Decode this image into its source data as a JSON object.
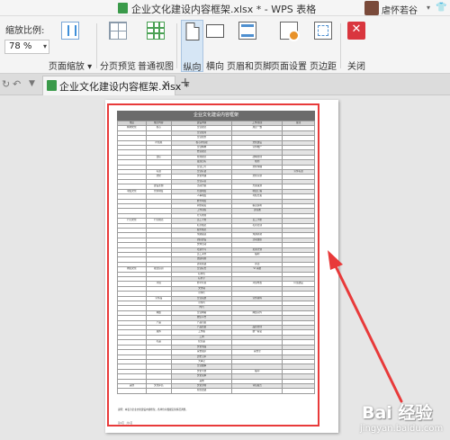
{
  "window": {
    "title": "企业文化建设内容框架.xlsx * - WPS 表格",
    "user_name": "虐怀若谷"
  },
  "ribbon": {
    "zoom_label": "缩放比例:",
    "zoom_value": "78 %",
    "buttons": {
      "page_zoom": "页面缩放",
      "page_break_preview": "分页预览",
      "normal_view": "普通视图",
      "portrait": "纵向",
      "landscape": "横向",
      "header_footer": "页眉和页脚",
      "page_setup": "页面设置",
      "margins": "页边距",
      "close": "关闭"
    }
  },
  "tabs": {
    "active_doc": "企业文化建设内容框架.xlsx *"
  },
  "preview_page": {
    "sheet_title": "企业文化建设内容框架",
    "header": [
      "维度",
      "细分内容",
      "建设内容",
      "工作/备注",
      "备注"
    ],
    "rows": [
      [
        "精神文化",
        "核心",
        "企业理念",
        "理念一致",
        ""
      ],
      [
        "",
        "",
        "企业使命",
        "",
        ""
      ],
      [
        "",
        "",
        "企业愿景",
        "",
        ""
      ],
      [
        "",
        "价值观",
        "核心价值观",
        "文化建设",
        ""
      ],
      [
        "",
        "",
        "企业精神",
        "宣传推广",
        ""
      ],
      [
        "",
        "",
        "经营理念",
        "",
        ""
      ],
      [
        "",
        "目标",
        "管理理念",
        "战略管理",
        ""
      ],
      [
        "",
        "",
        "发展目标",
        "规划",
        ""
      ],
      [
        "",
        "",
        "企业口号",
        "文化传播",
        ""
      ],
      [
        "",
        "标语",
        "企业标语",
        "",
        "宣传标语"
      ],
      [
        "",
        "文化",
        "文化内涵",
        "文化宣讲",
        ""
      ],
      [
        "",
        "",
        "企业宗旨",
        "",
        ""
      ],
      [
        "",
        "建设主题",
        "活动方案",
        "方案策划",
        ""
      ],
      [
        "制度文化",
        "管理制度",
        "行政制度",
        "制度汇编",
        ""
      ],
      [
        "",
        "",
        "人事制度",
        "考核方案",
        ""
      ],
      [
        "",
        "",
        "财务制度",
        "",
        ""
      ],
      [
        "",
        "",
        "岗位职责",
        "职责说明",
        ""
      ],
      [
        "",
        "",
        "工作流程",
        "流程图",
        ""
      ],
      [
        "",
        "",
        "行为准则",
        "",
        ""
      ],
      [
        "行为文化",
        "行为规范",
        "员工守则",
        "员工手册",
        ""
      ],
      [
        "",
        "",
        "礼仪规范",
        "礼仪培训",
        ""
      ],
      [
        "",
        "",
        "服务规范",
        "",
        ""
      ],
      [
        "",
        "",
        "沟通渠道",
        "沟通机制",
        ""
      ],
      [
        "",
        "",
        "团队建设",
        "活动组织",
        ""
      ],
      [
        "",
        "",
        "文体活动",
        "",
        ""
      ],
      [
        "",
        "",
        "培训学习",
        "培训计划",
        ""
      ],
      [
        "",
        "",
        "员工关怀",
        "福利",
        ""
      ],
      [
        "",
        "",
        "激励机制",
        "",
        ""
      ],
      [
        "",
        "",
        "表彰先进",
        "评选",
        ""
      ],
      [
        "物质文化",
        "视觉识别",
        "企业标志",
        "VI 系统",
        ""
      ],
      [
        "",
        "",
        "标准色",
        "",
        ""
      ],
      [
        "",
        "",
        "标准字",
        "",
        ""
      ],
      [
        "",
        "环境",
        "办公环境",
        "环境布置",
        "环境建设"
      ],
      [
        "",
        "",
        "文化墙",
        "",
        ""
      ],
      [
        "",
        "",
        "宣传栏",
        "",
        ""
      ],
      [
        "",
        "宣传品",
        "企业画册",
        "宣传资料",
        ""
      ],
      [
        "",
        "",
        "宣传片",
        "",
        ""
      ],
      [
        "",
        "",
        "内刊",
        "",
        ""
      ],
      [
        "",
        "网络",
        "企业网站",
        "网络宣传",
        ""
      ],
      [
        "",
        "",
        "微信平台",
        "",
        ""
      ],
      [
        "",
        "产品",
        "产品包装",
        "",
        ""
      ],
      [
        "",
        "",
        "产品质量",
        "品质管理",
        ""
      ],
      [
        "",
        "服饰",
        "工作服",
        "统一着装",
        ""
      ],
      [
        "",
        "",
        "工牌",
        "",
        ""
      ],
      [
        "",
        "礼品",
        "纪念品",
        "",
        ""
      ],
      [
        "",
        "",
        "文化用品",
        "",
        ""
      ],
      [
        "",
        "",
        "荣誉展示",
        "荣誉室",
        ""
      ],
      [
        "",
        "",
        "历史沿革",
        "",
        ""
      ],
      [
        "",
        "",
        "大事记",
        "",
        ""
      ],
      [
        "",
        "",
        "企业故事",
        "",
        ""
      ],
      [
        "",
        "",
        "文化手册",
        "编印",
        ""
      ],
      [
        "",
        "",
        "文化读本",
        "",
        ""
      ],
      [
        "",
        "",
        "其他",
        "",
        ""
      ],
      [
        "其他",
        "文化评估",
        "文化诊断",
        "评估报告",
        ""
      ],
      [
        "",
        "",
        "持续改进",
        "",
        ""
      ]
    ],
    "note": "说明：本表为企业文化建设内容框架，各单位可根据实际情况调整。",
    "footer": "第1页　共1页"
  },
  "watermark": {
    "brand": "Bai 经验",
    "url": "jingyan.baidu.com"
  },
  "colors": {
    "highlight": "#e83a3a",
    "active_button": "#d6e6f5",
    "title_bar_bg": "#6b6b6b"
  }
}
